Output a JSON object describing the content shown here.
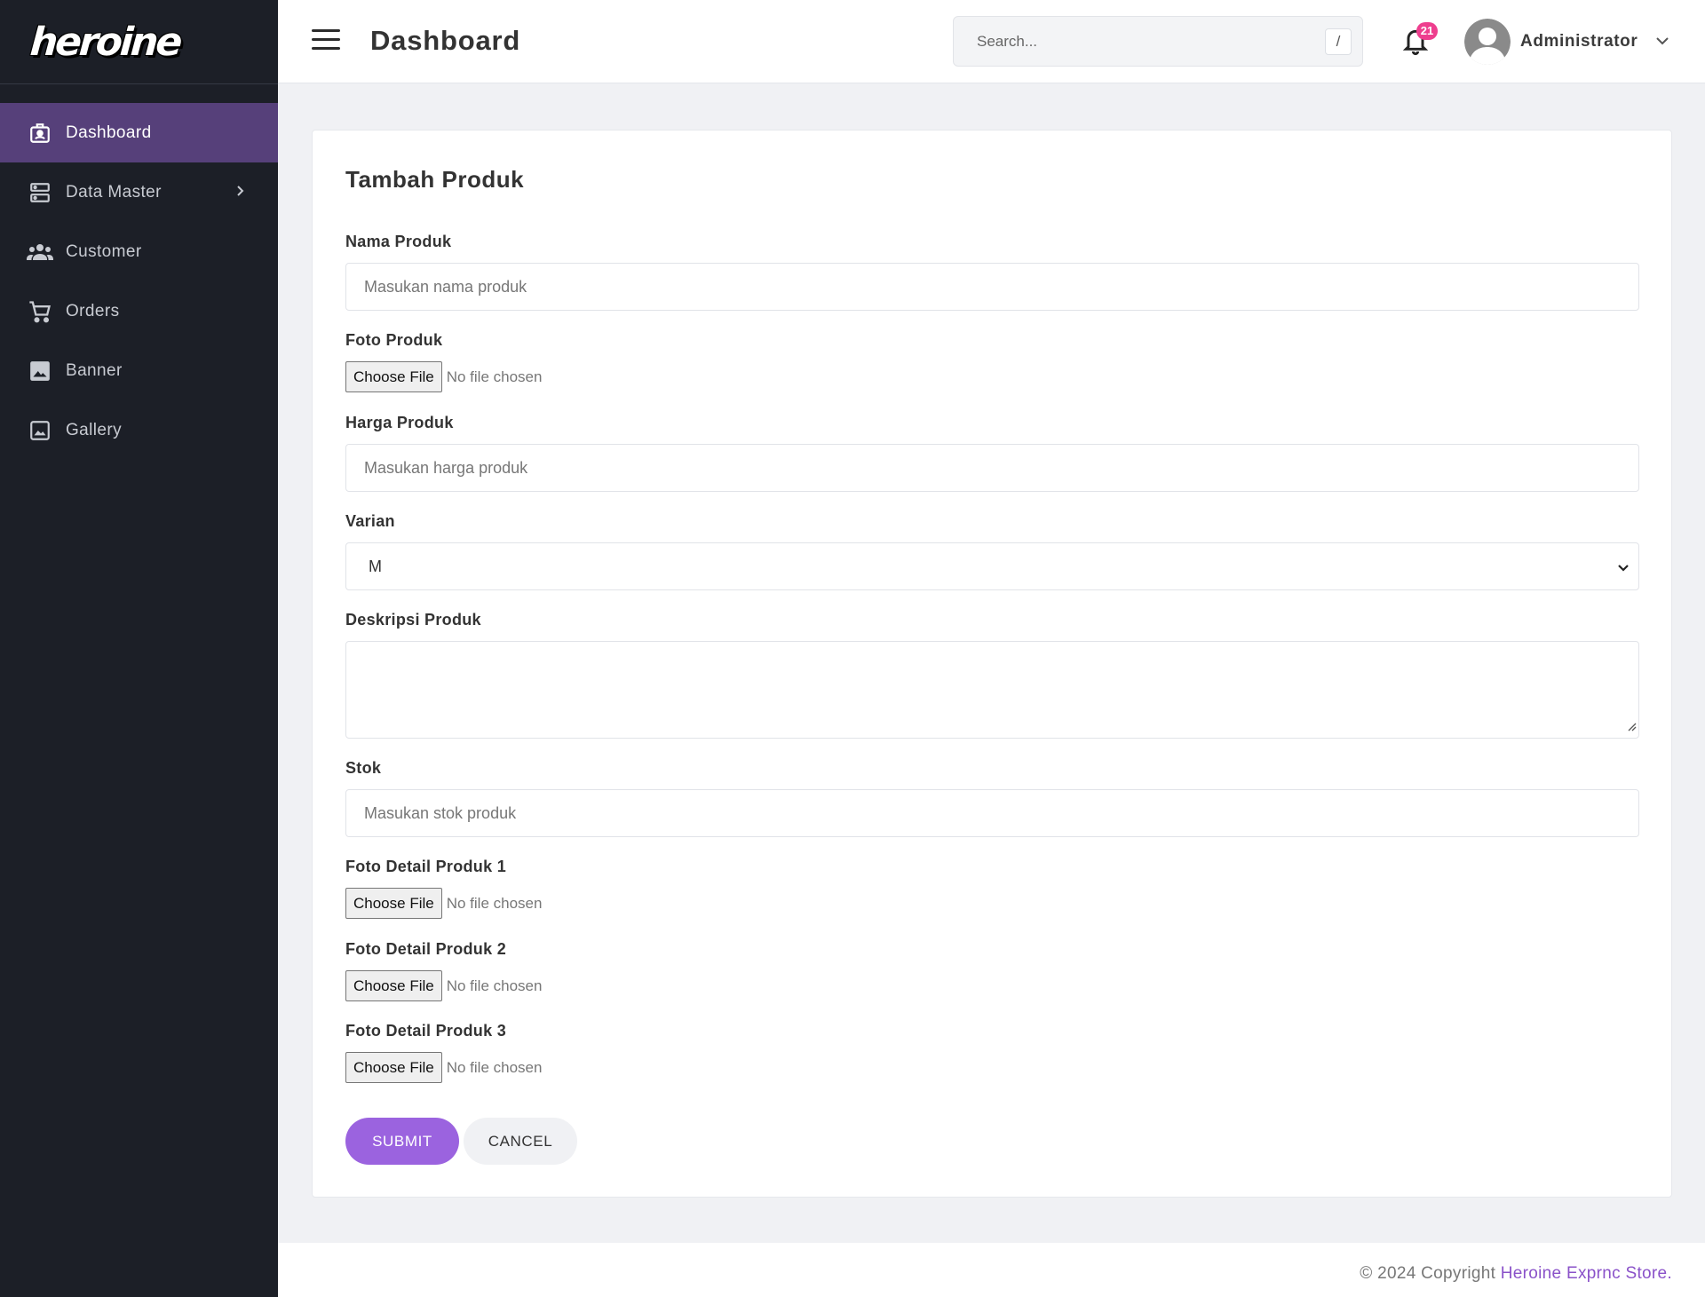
{
  "brand": {
    "logo_text": "heroine"
  },
  "sidebar": {
    "items": [
      {
        "label": "Dashboard",
        "icon": "contact-card-icon",
        "active": true
      },
      {
        "label": "Data Master",
        "icon": "server-icon",
        "has_submenu": true
      },
      {
        "label": "Customer",
        "icon": "people-icon"
      },
      {
        "label": "Orders",
        "icon": "cart-icon"
      },
      {
        "label": "Banner",
        "icon": "image-icon"
      },
      {
        "label": "Gallery",
        "icon": "picture-frame-icon"
      }
    ]
  },
  "header": {
    "title": "Dashboard",
    "search_placeholder": "Search...",
    "search_shortcut": "/",
    "notification_count": "21",
    "user_name": "Administrator"
  },
  "form": {
    "title": "Tambah Produk",
    "nama_label": "Nama Produk",
    "nama_placeholder": "Masukan nama produk",
    "foto_label": "Foto Produk",
    "file_button": "Choose File",
    "file_status": "No file chosen",
    "harga_label": "Harga Produk",
    "harga_placeholder": "Masukan harga produk",
    "varian_label": "Varian",
    "varian_value": "M",
    "deskripsi_label": "Deskripsi Produk",
    "stok_label": "Stok",
    "stok_placeholder": "Masukan stok produk",
    "detail1_label": "Foto Detail Produk 1",
    "detail2_label": "Foto Detail Produk 2",
    "detail3_label": "Foto Detail Produk 3",
    "submit_label": "SUBMIT",
    "cancel_label": "CANCEL"
  },
  "footer": {
    "copyright": "© 2024 Copyright ",
    "store_link": "Heroine Exprnc Store."
  },
  "colors": {
    "sidebar_bg": "#1c1f27",
    "active_item": "#56407a",
    "accent": "#9b63df",
    "badge": "#ee3e8e",
    "link": "#8a52c9"
  }
}
